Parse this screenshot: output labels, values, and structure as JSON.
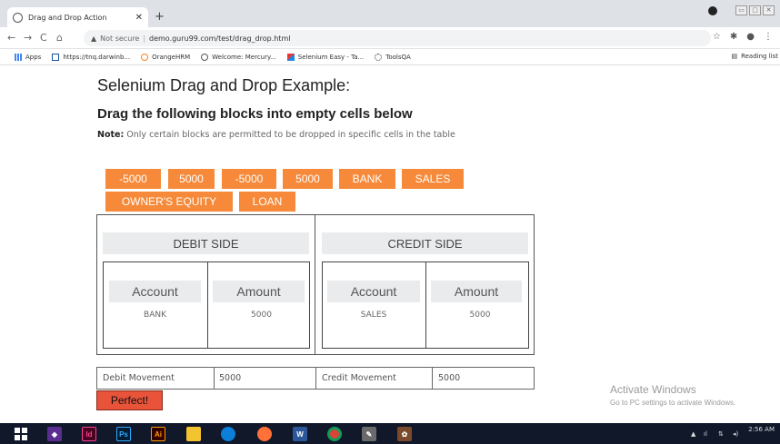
{
  "browser": {
    "tab_title": "Drag and Drop Action",
    "url_warning": "Not secure",
    "url": "demo.guru99.com/test/drag_drop.html",
    "bookmarks": [
      "Apps",
      "https://tnq.darwinb...",
      "OrangeHRM",
      "Welcome: Mercury...",
      "Selenium Easy - Ta...",
      "ToolsQA"
    ],
    "reading_list": "Reading list"
  },
  "page": {
    "title": "Selenium Drag and Drop Example:",
    "subtitle": "Drag the following blocks into empty cells below",
    "note_label": "Note:",
    "note_text": " Only certain blocks are permitted to be dropped in specific cells in the table"
  },
  "blocks": [
    "-5000",
    "5000",
    "-5000",
    "5000",
    "BANK",
    "SALES",
    "OWNER'S EQUITY",
    "LOAN"
  ],
  "debit": {
    "header": "DEBIT SIDE",
    "account_header": "Account",
    "amount_header": "Amount",
    "account_value": "BANK",
    "amount_value": "5000"
  },
  "credit": {
    "header": "CREDIT SIDE",
    "account_header": "Account",
    "amount_header": "Amount",
    "account_value": "SALES",
    "amount_value": "5000"
  },
  "movement": {
    "debit_label": "Debit Movement",
    "debit_value": "5000",
    "credit_label": "Credit Movement",
    "credit_value": "5000"
  },
  "result": "Perfect!",
  "watermark": {
    "line1": "Activate Windows",
    "line2": "Go to PC settings to activate Windows."
  },
  "taskbar": {
    "time": "2:56 AM"
  },
  "colors": {
    "block_orange": "#f68a3a",
    "perfect_red": "#e8533a"
  }
}
